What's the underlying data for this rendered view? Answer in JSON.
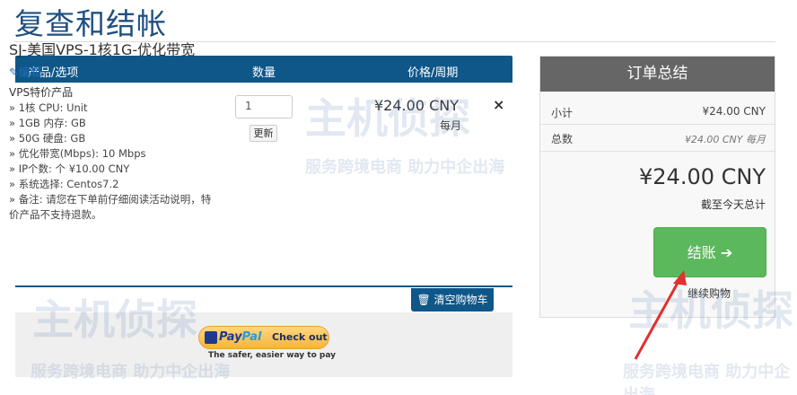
{
  "page": {
    "title": "复查和结帐"
  },
  "cart": {
    "headers": {
      "product": "产品/选项",
      "qty": "数量",
      "price": "价格/周期"
    },
    "item": {
      "name": "SJ-美国VPS-1核1G-优化带宽",
      "edit_label": "编辑",
      "group": "VPS特价产品",
      "options": [
        "» 1核 CPU: Unit",
        "» 1GB 内存: GB",
        "» 50G 硬盘: GB",
        "» 优化带宽(Mbps): 10 Mbps",
        "» IP个数: 个 ¥10.00 CNY",
        "» 系统选择: Centos7.2",
        "» 备注: 请您在下单前仔细阅读活动说明，特价产品不支持退款。"
      ],
      "qty": "1",
      "update_label": "更新",
      "price": "¥24.00 CNY",
      "cycle": "每月",
      "remove_symbol": "×"
    },
    "empty_label": "清空购物车"
  },
  "paypal": {
    "logo_pay": "Pay",
    "logo_pal": "Pal",
    "checkout": "Check out",
    "tagline": "The safer, easier way to pay"
  },
  "summary": {
    "title": "订单总结",
    "subtotal_label": "小计",
    "subtotal_value": "¥24.00 CNY",
    "total_label": "总数",
    "total_value": "¥24.00 CNY 每月",
    "due_today": "¥24.00 CNY",
    "due_today_note": "截至今天总计",
    "checkout_label": "结账 ➔",
    "continue_label": "继续购物"
  },
  "watermark": {
    "brand": "主机侦探",
    "slogan": "服务跨境电商 助力中企出海"
  },
  "colors": {
    "primary": "#0f5689",
    "success": "#5cb85c",
    "summary_head": "#666666",
    "arrow": "#e03030"
  }
}
